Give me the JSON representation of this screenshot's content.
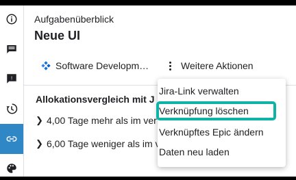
{
  "sidebar": {
    "items": [
      {
        "name": "info",
        "icon": "info-icon"
      },
      {
        "name": "feedback",
        "icon": "chat-icon"
      },
      {
        "name": "notes",
        "icon": "note-icon"
      },
      {
        "name": "history",
        "icon": "history-icon"
      },
      {
        "name": "link",
        "icon": "link-icon",
        "active": true
      },
      {
        "name": "palette",
        "icon": "palette-icon"
      }
    ],
    "active_color": "#2f87c6"
  },
  "header": {
    "subtitle": "Aufgabenüberblick",
    "title": "Neue UI"
  },
  "project": {
    "label": "Software Developm…",
    "icon": "jira-icon"
  },
  "actions": {
    "label": "Weitere Aktionen",
    "icon": "more-vertical-icon"
  },
  "section": {
    "heading": "Allokationsvergleich mit J",
    "rows": [
      "4,00 Tage mehr als im ver",
      "6,00 Tage weniger als im v"
    ]
  },
  "menu": {
    "items": [
      "Jira-Link verwalten",
      "Verknüpfung löschen",
      "Verknüpftes Epic ändern",
      "Daten neu laden"
    ],
    "highlighted_index": 1,
    "highlight_color": "#0fb3a5"
  }
}
